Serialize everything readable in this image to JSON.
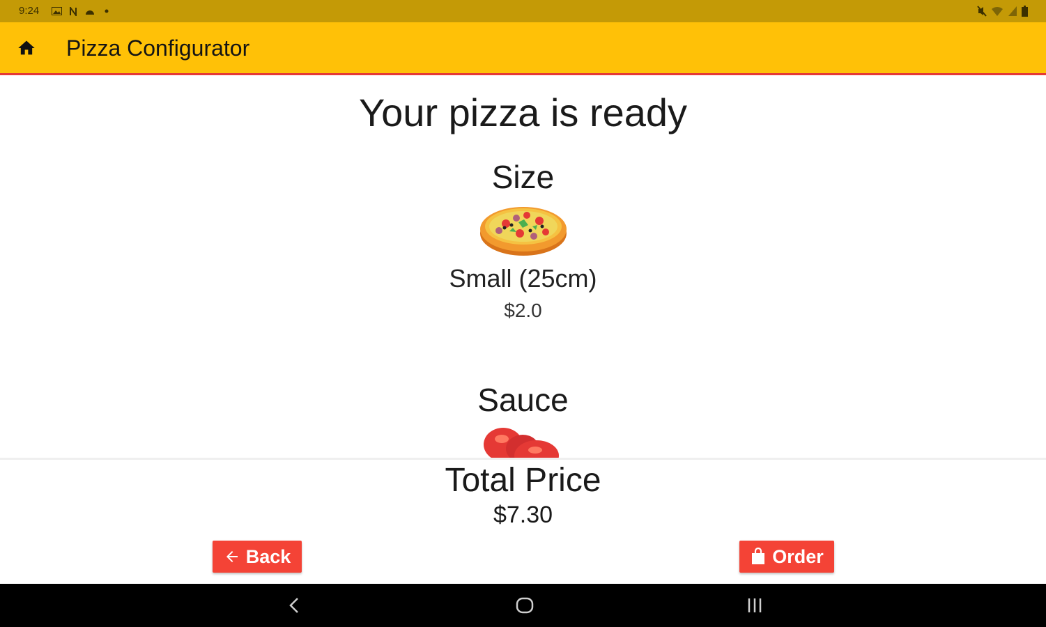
{
  "status_bar": {
    "time": "9:24",
    "left_icons": [
      "image-icon",
      "n-icon",
      "android-icon",
      "dot-icon"
    ],
    "right_icons": [
      "mute-icon",
      "wifi-icon",
      "signal-icon",
      "battery-icon"
    ]
  },
  "app_bar": {
    "title": "Pizza Configurator",
    "icon": "home-icon"
  },
  "main": {
    "heading": "Your pizza is ready",
    "size_section": {
      "title": "Size",
      "image": "pizza-icon",
      "value": "Small (25cm)",
      "price": "$2.0"
    },
    "sauce_section": {
      "title": "Sauce",
      "image": "tomato-icon"
    }
  },
  "total": {
    "label": "Total Price",
    "value": "$7.30"
  },
  "buttons": {
    "back_label": "Back",
    "order_label": "Order"
  },
  "nav_bar": {
    "icons": [
      "nav-back-icon",
      "nav-home-icon",
      "nav-recent-icon"
    ]
  },
  "colors": {
    "status_bar": "#c49a06",
    "app_bar": "#ffc107",
    "accent_line": "#e53935",
    "button": "#f44336",
    "nav_bar": "#000000"
  }
}
